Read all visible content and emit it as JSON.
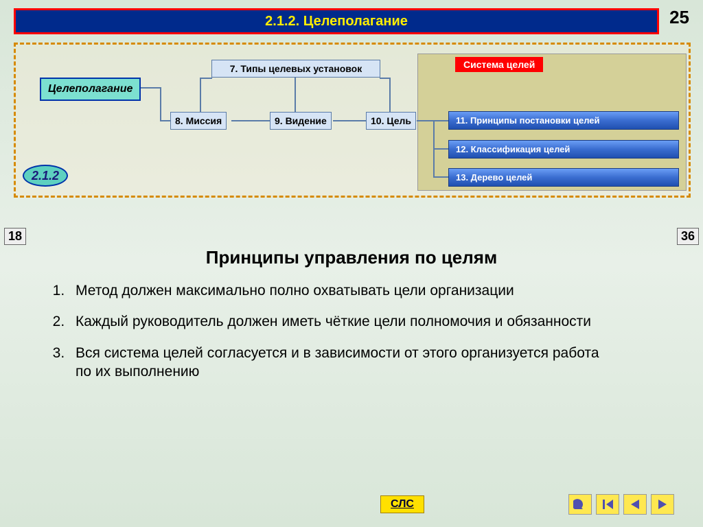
{
  "header": {
    "title": "2.1.2. Целеполагание"
  },
  "page_number": "25",
  "diagram": {
    "main_node": "Целеполагание",
    "section_badge": "2.1.2",
    "system_label": "Система целей",
    "nodes": {
      "n7": "7. Типы целевых установок",
      "n8": "8. Миссия",
      "n9": "9. Видение",
      "n10": "10. Цель",
      "n11": "11. Принципы постановки целей",
      "n12": "12. Классификация целей",
      "n13": "13. Дерево целей"
    }
  },
  "nav": {
    "prev": "18",
    "next": "36"
  },
  "content": {
    "title": "Принципы управления по целям",
    "items": [
      "Метод должен максимально полно охватывать цели организации",
      "Каждый руководитель должен иметь чёткие цели полномочия и обязанности",
      "Вся система целей согласуется и в зависимости от этого организуется работа по их выполнению"
    ]
  },
  "footer": {
    "sls": "СЛС"
  }
}
